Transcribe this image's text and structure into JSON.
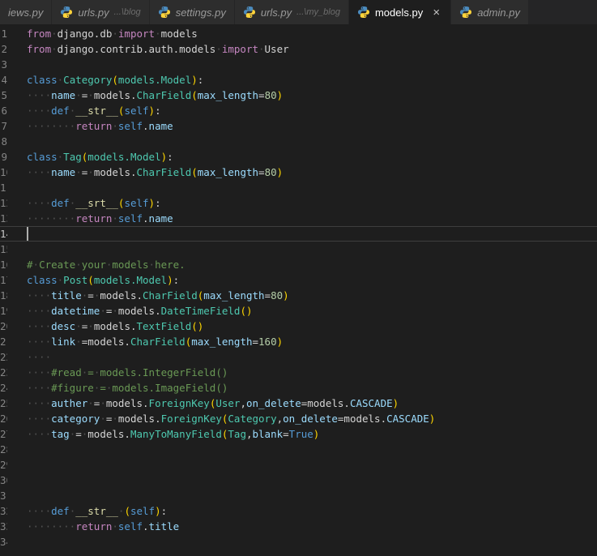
{
  "window": {
    "background": "#1e1e1e",
    "tabbar_background": "#252526",
    "active_tab_background": "#1e1e1e",
    "inactive_tab_background": "#2d2d2d"
  },
  "tabs": [
    {
      "label": "iews.py",
      "icon": false,
      "active": false
    },
    {
      "label": "urls.py",
      "desc": "...\\blog",
      "icon": "python-icon",
      "active": false
    },
    {
      "label": "settings.py",
      "icon": "python-icon",
      "active": false
    },
    {
      "label": "urls.py",
      "desc": "...\\my_blog",
      "icon": "python-icon",
      "active": false
    },
    {
      "label": "models.py",
      "icon": "python-icon",
      "active": true,
      "close": "×"
    },
    {
      "label": "admin.py",
      "icon": "python-icon",
      "active": false
    }
  ],
  "colors": {
    "keyword_control": "#c586c0",
    "keyword": "#569cd6",
    "class_name": "#4ec9b0",
    "function_name": "#dcdcaa",
    "variable": "#9cdcfe",
    "number": "#b5cea8",
    "plain_text": "#d4d4d4",
    "comment": "#6a9955",
    "whitespace_dot": "#515151",
    "bracket": "#ffd700",
    "line_number": "#858585",
    "active_line_number": "#c6c6c6"
  },
  "editor": {
    "cursor_line": 14,
    "line_count": 34,
    "lines": [
      [
        [
          "k1",
          "from"
        ],
        [
          "ws",
          "·"
        ],
        [
          "txt",
          "django.db"
        ],
        [
          "ws",
          "·"
        ],
        [
          "k1",
          "import"
        ],
        [
          "ws",
          "·"
        ],
        [
          "txt",
          "models"
        ]
      ],
      [
        [
          "k1",
          "from"
        ],
        [
          "ws",
          "·"
        ],
        [
          "txt",
          "django.contrib.auth.models"
        ],
        [
          "ws",
          "·"
        ],
        [
          "k1",
          "import"
        ],
        [
          "ws",
          "·"
        ],
        [
          "txt",
          "User"
        ]
      ],
      [],
      [
        [
          "k2",
          "class"
        ],
        [
          "ws",
          "·"
        ],
        [
          "cls",
          "Category"
        ],
        [
          "p",
          "("
        ],
        [
          "cls",
          "models.Model"
        ],
        [
          "p",
          ")"
        ],
        [
          "txt",
          ":"
        ]
      ],
      [
        [
          "ws",
          "····"
        ],
        [
          "var",
          "name"
        ],
        [
          "ws",
          "·"
        ],
        [
          "txt",
          "="
        ],
        [
          "ws",
          "·"
        ],
        [
          "txt",
          "models."
        ],
        [
          "cls",
          "CharField"
        ],
        [
          "p",
          "("
        ],
        [
          "var",
          "max_length"
        ],
        [
          "txt",
          "="
        ],
        [
          "num",
          "80"
        ],
        [
          "p",
          ")"
        ]
      ],
      [
        [
          "ws",
          "····"
        ],
        [
          "k2",
          "def"
        ],
        [
          "ws",
          "·"
        ],
        [
          "fn",
          "__str__"
        ],
        [
          "p",
          "("
        ],
        [
          "k2",
          "self"
        ],
        [
          "p",
          ")"
        ],
        [
          "txt",
          ":"
        ]
      ],
      [
        [
          "ws",
          "········"
        ],
        [
          "k1",
          "return"
        ],
        [
          "ws",
          "·"
        ],
        [
          "k2",
          "self"
        ],
        [
          "txt",
          "."
        ],
        [
          "var",
          "name"
        ]
      ],
      [],
      [
        [
          "k2",
          "class"
        ],
        [
          "ws",
          "·"
        ],
        [
          "cls",
          "Tag"
        ],
        [
          "p",
          "("
        ],
        [
          "cls",
          "models.Model"
        ],
        [
          "p",
          ")"
        ],
        [
          "txt",
          ":"
        ]
      ],
      [
        [
          "ws",
          "····"
        ],
        [
          "var",
          "name"
        ],
        [
          "ws",
          "·"
        ],
        [
          "txt",
          "="
        ],
        [
          "ws",
          "·"
        ],
        [
          "txt",
          "models."
        ],
        [
          "cls",
          "CharField"
        ],
        [
          "p",
          "("
        ],
        [
          "var",
          "max_length"
        ],
        [
          "txt",
          "="
        ],
        [
          "num",
          "80"
        ],
        [
          "p",
          ")"
        ]
      ],
      [],
      [
        [
          "ws",
          "····"
        ],
        [
          "k2",
          "def"
        ],
        [
          "ws",
          "·"
        ],
        [
          "fn",
          "__srt__"
        ],
        [
          "p",
          "("
        ],
        [
          "k2",
          "self"
        ],
        [
          "p",
          ")"
        ],
        [
          "txt",
          ":"
        ]
      ],
      [
        [
          "ws",
          "········"
        ],
        [
          "k1",
          "return"
        ],
        [
          "ws",
          "·"
        ],
        [
          "k2",
          "self"
        ],
        [
          "txt",
          "."
        ],
        [
          "var",
          "name"
        ]
      ],
      [],
      [],
      [
        [
          "com",
          "#"
        ],
        [
          "ws",
          "·"
        ],
        [
          "com",
          "Create"
        ],
        [
          "ws",
          "·"
        ],
        [
          "com",
          "your"
        ],
        [
          "ws",
          "·"
        ],
        [
          "com",
          "models"
        ],
        [
          "ws",
          "·"
        ],
        [
          "com",
          "here."
        ]
      ],
      [
        [
          "k2",
          "class"
        ],
        [
          "ws",
          "·"
        ],
        [
          "cls",
          "Post"
        ],
        [
          "p",
          "("
        ],
        [
          "cls",
          "models.Model"
        ],
        [
          "p",
          ")"
        ],
        [
          "txt",
          ":"
        ]
      ],
      [
        [
          "ws",
          "····"
        ],
        [
          "var",
          "title"
        ],
        [
          "ws",
          "·"
        ],
        [
          "txt",
          "="
        ],
        [
          "ws",
          "·"
        ],
        [
          "txt",
          "models."
        ],
        [
          "cls",
          "CharField"
        ],
        [
          "p",
          "("
        ],
        [
          "var",
          "max_length"
        ],
        [
          "txt",
          "="
        ],
        [
          "num",
          "80"
        ],
        [
          "p",
          ")"
        ]
      ],
      [
        [
          "ws",
          "····"
        ],
        [
          "var",
          "datetime"
        ],
        [
          "ws",
          "·"
        ],
        [
          "txt",
          "="
        ],
        [
          "ws",
          "·"
        ],
        [
          "txt",
          "models."
        ],
        [
          "cls",
          "DateTimeField"
        ],
        [
          "p",
          "()"
        ]
      ],
      [
        [
          "ws",
          "····"
        ],
        [
          "var",
          "desc"
        ],
        [
          "ws",
          "·"
        ],
        [
          "txt",
          "="
        ],
        [
          "ws",
          "·"
        ],
        [
          "txt",
          "models."
        ],
        [
          "cls",
          "TextField"
        ],
        [
          "p",
          "()"
        ]
      ],
      [
        [
          "ws",
          "····"
        ],
        [
          "var",
          "link"
        ],
        [
          "ws",
          "·"
        ],
        [
          "txt",
          "="
        ],
        [
          "txt",
          "models."
        ],
        [
          "cls",
          "CharField"
        ],
        [
          "p",
          "("
        ],
        [
          "var",
          "max_length"
        ],
        [
          "txt",
          "="
        ],
        [
          "num",
          "160"
        ],
        [
          "p",
          ")"
        ]
      ],
      [
        [
          "ws",
          "····"
        ]
      ],
      [
        [
          "ws",
          "····"
        ],
        [
          "com",
          "#read"
        ],
        [
          "ws",
          "·"
        ],
        [
          "com",
          "="
        ],
        [
          "ws",
          "·"
        ],
        [
          "com",
          "models.IntegerField()"
        ]
      ],
      [
        [
          "ws",
          "····"
        ],
        [
          "com",
          "#figure"
        ],
        [
          "ws",
          "·"
        ],
        [
          "com",
          "="
        ],
        [
          "ws",
          "·"
        ],
        [
          "com",
          "models.ImageField()"
        ]
      ],
      [
        [
          "ws",
          "····"
        ],
        [
          "var",
          "auther"
        ],
        [
          "ws",
          "·"
        ],
        [
          "txt",
          "="
        ],
        [
          "ws",
          "·"
        ],
        [
          "txt",
          "models."
        ],
        [
          "cls",
          "ForeignKey"
        ],
        [
          "p",
          "("
        ],
        [
          "cls",
          "User"
        ],
        [
          "txt",
          ","
        ],
        [
          "var",
          "on_delete"
        ],
        [
          "txt",
          "="
        ],
        [
          "txt",
          "models."
        ],
        [
          "var",
          "CASCADE"
        ],
        [
          "p",
          ")"
        ]
      ],
      [
        [
          "ws",
          "····"
        ],
        [
          "var",
          "category"
        ],
        [
          "ws",
          "·"
        ],
        [
          "txt",
          "="
        ],
        [
          "ws",
          "·"
        ],
        [
          "txt",
          "models."
        ],
        [
          "cls",
          "ForeignKey"
        ],
        [
          "p",
          "("
        ],
        [
          "cls",
          "Category"
        ],
        [
          "txt",
          ","
        ],
        [
          "var",
          "on_delete"
        ],
        [
          "txt",
          "="
        ],
        [
          "txt",
          "models."
        ],
        [
          "var",
          "CASCADE"
        ],
        [
          "p",
          ")"
        ]
      ],
      [
        [
          "ws",
          "····"
        ],
        [
          "var",
          "tag"
        ],
        [
          "ws",
          "·"
        ],
        [
          "txt",
          "="
        ],
        [
          "ws",
          "·"
        ],
        [
          "txt",
          "models."
        ],
        [
          "cls",
          "ManyToManyField"
        ],
        [
          "p",
          "("
        ],
        [
          "cls",
          "Tag"
        ],
        [
          "txt",
          ","
        ],
        [
          "var",
          "blank"
        ],
        [
          "txt",
          "="
        ],
        [
          "k2",
          "True"
        ],
        [
          "p",
          ")"
        ]
      ],
      [],
      [],
      [],
      [],
      [
        [
          "ws",
          "····"
        ],
        [
          "k2",
          "def"
        ],
        [
          "ws",
          "·"
        ],
        [
          "fn",
          "__str__"
        ],
        [
          "ws",
          "·"
        ],
        [
          "p",
          "("
        ],
        [
          "k2",
          "self"
        ],
        [
          "p",
          ")"
        ],
        [
          "txt",
          ":"
        ]
      ],
      [
        [
          "ws",
          "········"
        ],
        [
          "k1",
          "return"
        ],
        [
          "ws",
          "·"
        ],
        [
          "k2",
          "self"
        ],
        [
          "txt",
          "."
        ],
        [
          "var",
          "title"
        ]
      ],
      []
    ]
  }
}
